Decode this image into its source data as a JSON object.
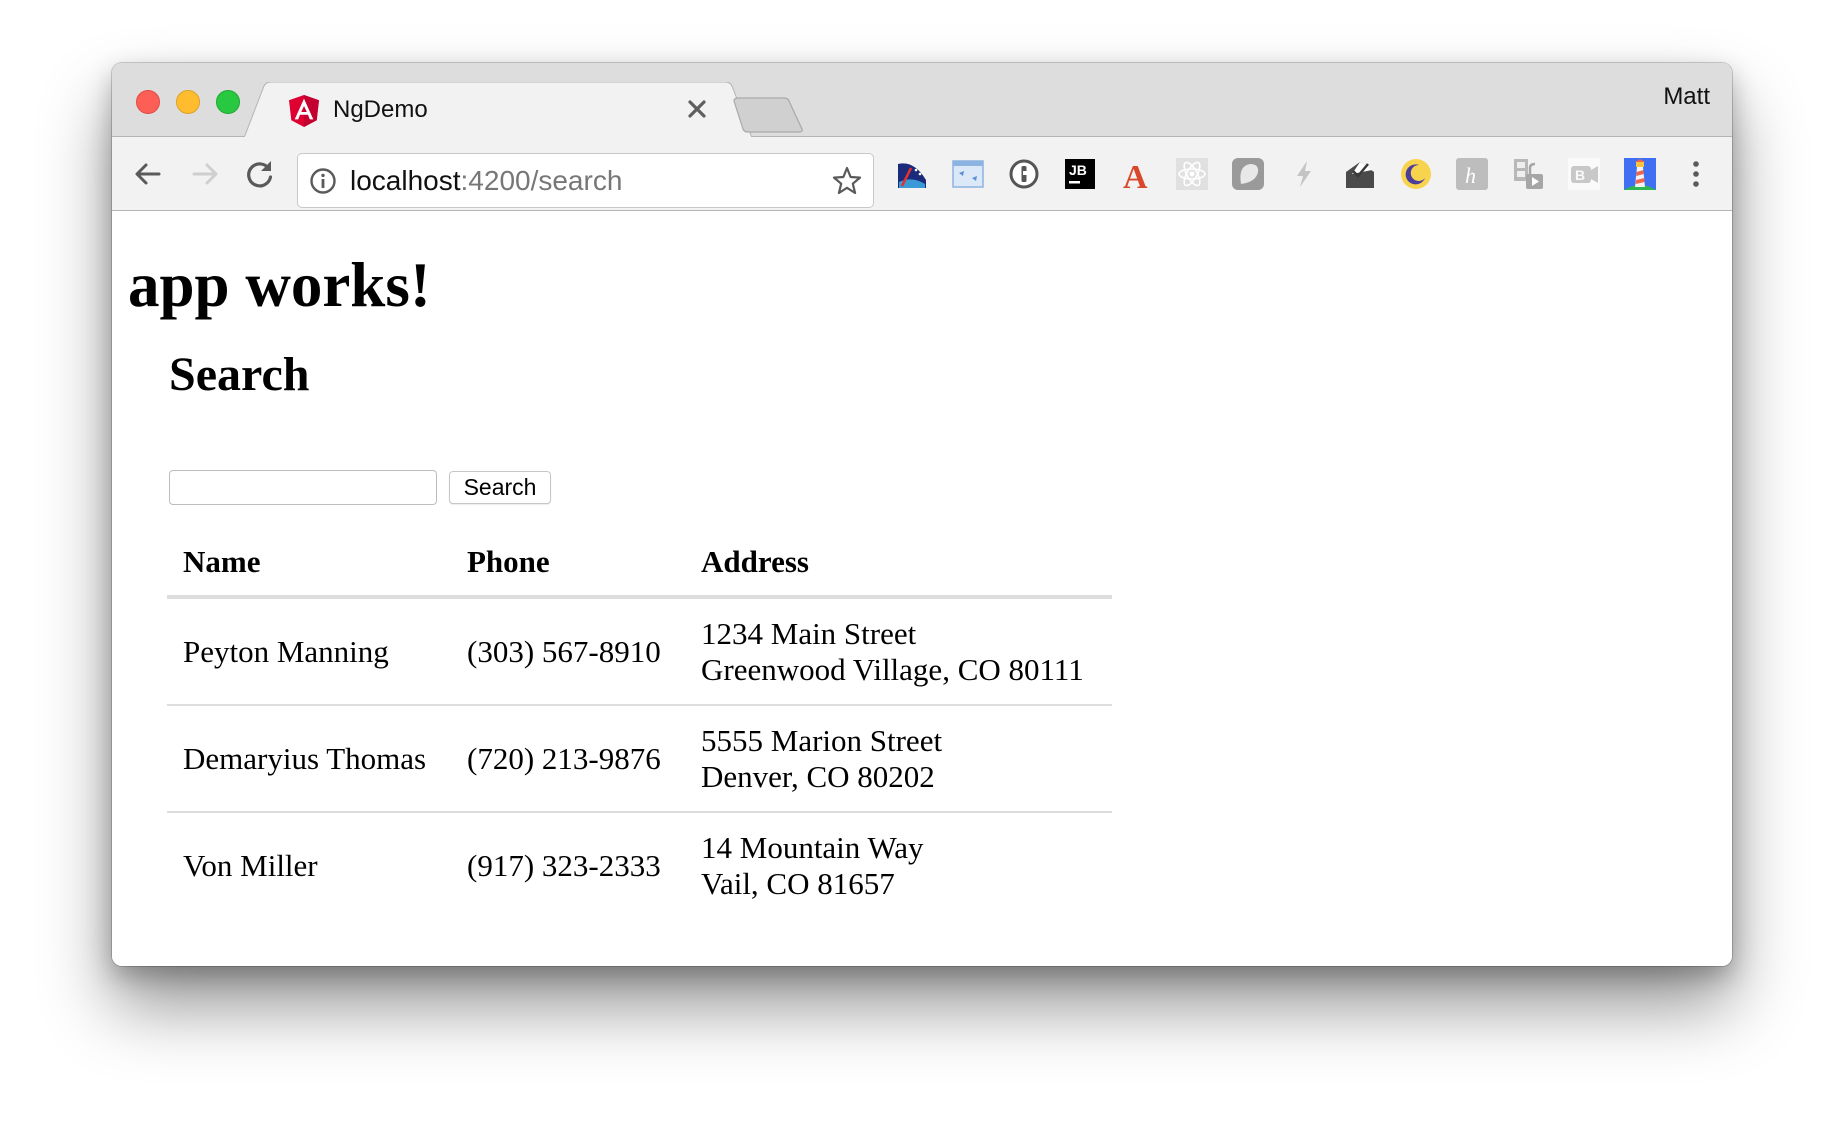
{
  "browser": {
    "tab": {
      "title": "NgDemo",
      "favicon": "angular-icon",
      "close_label": "×"
    },
    "profile_name": "Matt",
    "address_bar": {
      "host": "localhost",
      "rest": ":4200/search",
      "info_icon": "info-icon",
      "bookmark_icon": "star-icon"
    },
    "nav": {
      "back_icon": "arrow-left-icon",
      "forward_icon": "arrow-right-icon",
      "reload_icon": "reload-icon"
    },
    "extensions": [
      {
        "name": "speed-gauge-icon"
      },
      {
        "name": "window-arrows-icon"
      },
      {
        "name": "1password-icon"
      },
      {
        "name": "jetbrains-icon"
      },
      {
        "name": "font-a-icon"
      },
      {
        "name": "react-devtools-icon"
      },
      {
        "name": "ghostery-icon"
      },
      {
        "name": "lightning-icon"
      },
      {
        "name": "mail-check-icon"
      },
      {
        "name": "moon-icon"
      },
      {
        "name": "honey-h-icon"
      },
      {
        "name": "video-unlock-icon"
      },
      {
        "name": "b-video-icon"
      },
      {
        "name": "lighthouse-icon"
      }
    ],
    "menu_icon": "more-vertical-icon"
  },
  "page": {
    "heading": "app works!",
    "search": {
      "title": "Search",
      "input_value": "",
      "input_placeholder": "",
      "button_label": "Search"
    },
    "table": {
      "headers": [
        "Name",
        "Phone",
        "Address"
      ],
      "rows": [
        {
          "name": "Peyton Manning",
          "phone": "(303) 567-8910",
          "address_line1": "1234 Main Street",
          "address_line2": "Greenwood Village, CO 80111"
        },
        {
          "name": "Demaryius Thomas",
          "phone": "(720) 213-9876",
          "address_line1": "5555 Marion Street",
          "address_line2": "Denver, CO 80202"
        },
        {
          "name": "Von Miller",
          "phone": "(917) 323-2333",
          "address_line1": "14 Mountain Way",
          "address_line2": "Vail, CO 81657"
        }
      ]
    }
  },
  "colors": {
    "angular_red": "#dd0031",
    "border_light": "#dddddd",
    "tabstrip_bg": "#dddddd",
    "toolbar_bg": "#f2f2f2"
  }
}
